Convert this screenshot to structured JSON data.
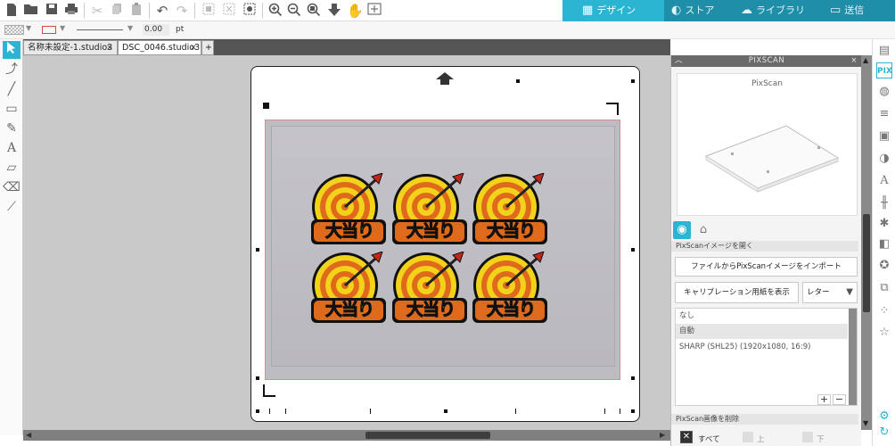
{
  "toolbar": {
    "icons": [
      "new-doc-icon",
      "open-folder-icon",
      "save-icon",
      "print-icon",
      "cut-icon",
      "copy-icon",
      "paste-icon",
      "undo-icon",
      "redo-icon",
      "group-icon",
      "ungroup-icon",
      "select-all-icon",
      "zoom-in-icon",
      "zoom-out-icon",
      "zoom-fit-icon",
      "move-down-icon",
      "pan-hand-icon",
      "add-page-icon"
    ]
  },
  "nav": {
    "design": "デザイン",
    "store": "ストア",
    "library": "ライブラリ",
    "send": "送信"
  },
  "linebar": {
    "line_width": "0.00",
    "unit": "pt",
    "stroke_color": "#d44"
  },
  "tabs": [
    {
      "label": "名称未設定-1.studio3",
      "close": "×"
    },
    {
      "label": "DSC_0046.studio3",
      "close": "×"
    }
  ],
  "add_tab": "+",
  "sticker_text": "大当り",
  "panel": {
    "title": "PIXSCAN",
    "preview_title": "PixScan",
    "open_section": "PixScanイメージを開く",
    "import_button": "ファイルからPixScanイメージをインポート",
    "calibration_button": "キャリブレーション用紙を表示",
    "paper_select": "レター",
    "list": [
      "なし",
      "自動",
      "SHARP (SHL25) (1920x1080, 16:9)"
    ],
    "selected_index": 1,
    "list_add": "+",
    "list_remove": "−",
    "delete_section": "PixScan画像を削除",
    "all_label": "すべて",
    "up_label": "上",
    "down_label": "下"
  },
  "colors": {
    "accent": "#2bb5d3",
    "nav_bg": "#1f8ea8"
  }
}
